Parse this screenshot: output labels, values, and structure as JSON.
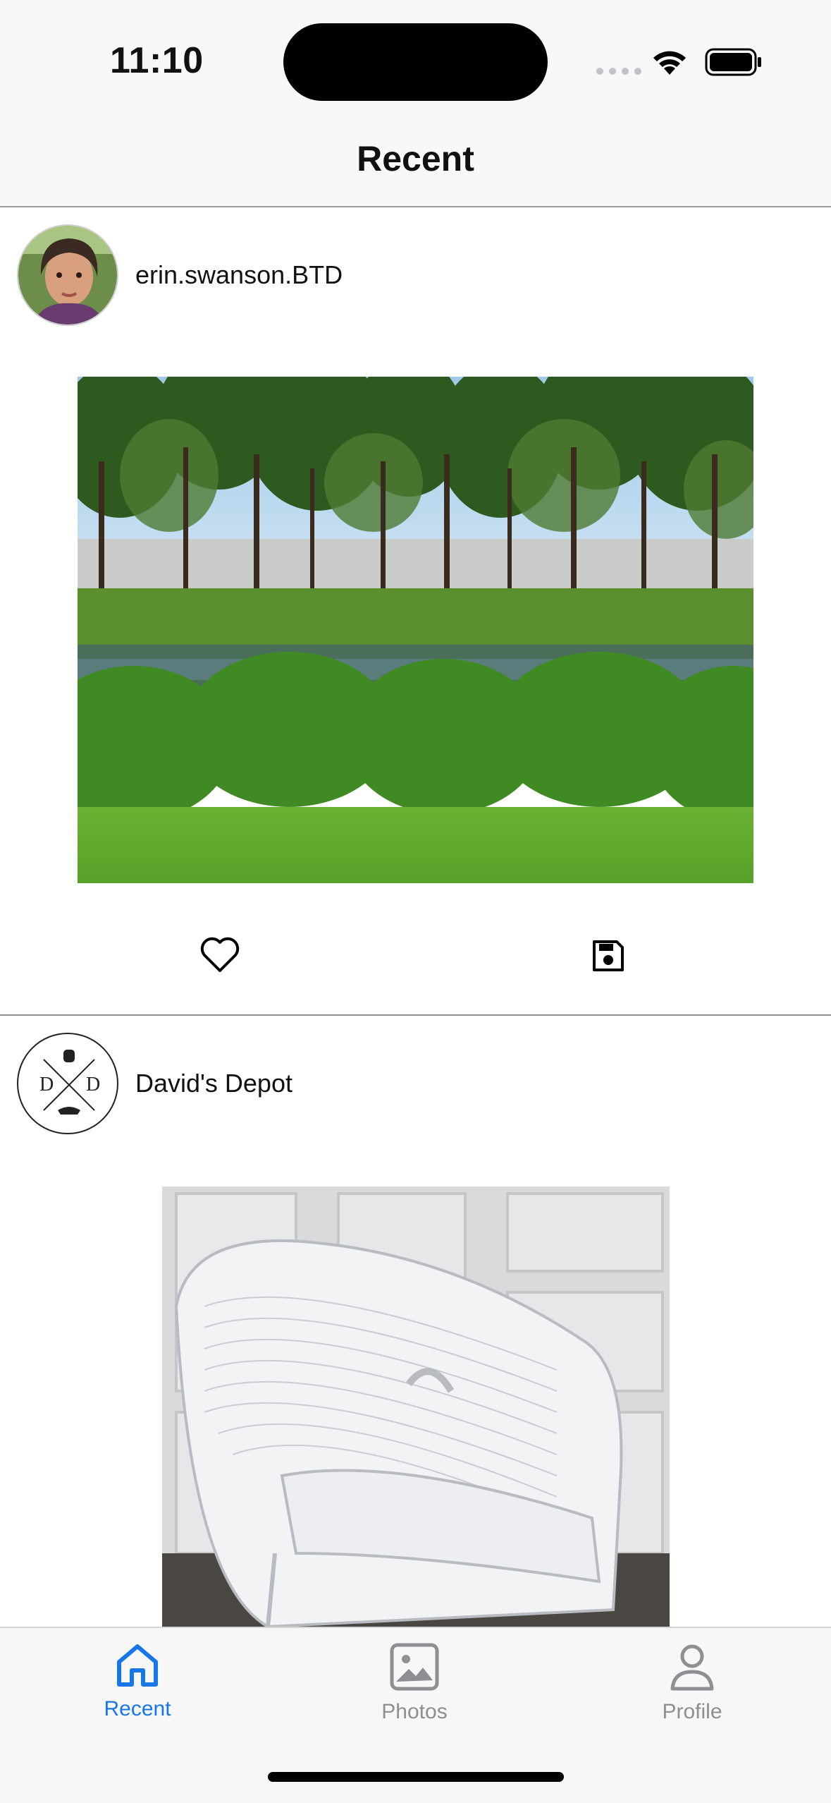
{
  "status_bar": {
    "time": "11:10"
  },
  "nav": {
    "title": "Recent"
  },
  "posts": [
    {
      "username": "erin.swanson.BTD"
    },
    {
      "username": "David's Depot",
      "logo_letters": [
        "D",
        "D"
      ]
    }
  ],
  "tabs": [
    {
      "label": "Recent",
      "icon": "home-icon",
      "active": true
    },
    {
      "label": "Photos",
      "icon": "photo-icon",
      "active": false
    },
    {
      "label": "Profile",
      "icon": "person-icon",
      "active": false
    }
  ],
  "colors": {
    "accent": "#1877e8",
    "inactive": "#8e8e93"
  }
}
